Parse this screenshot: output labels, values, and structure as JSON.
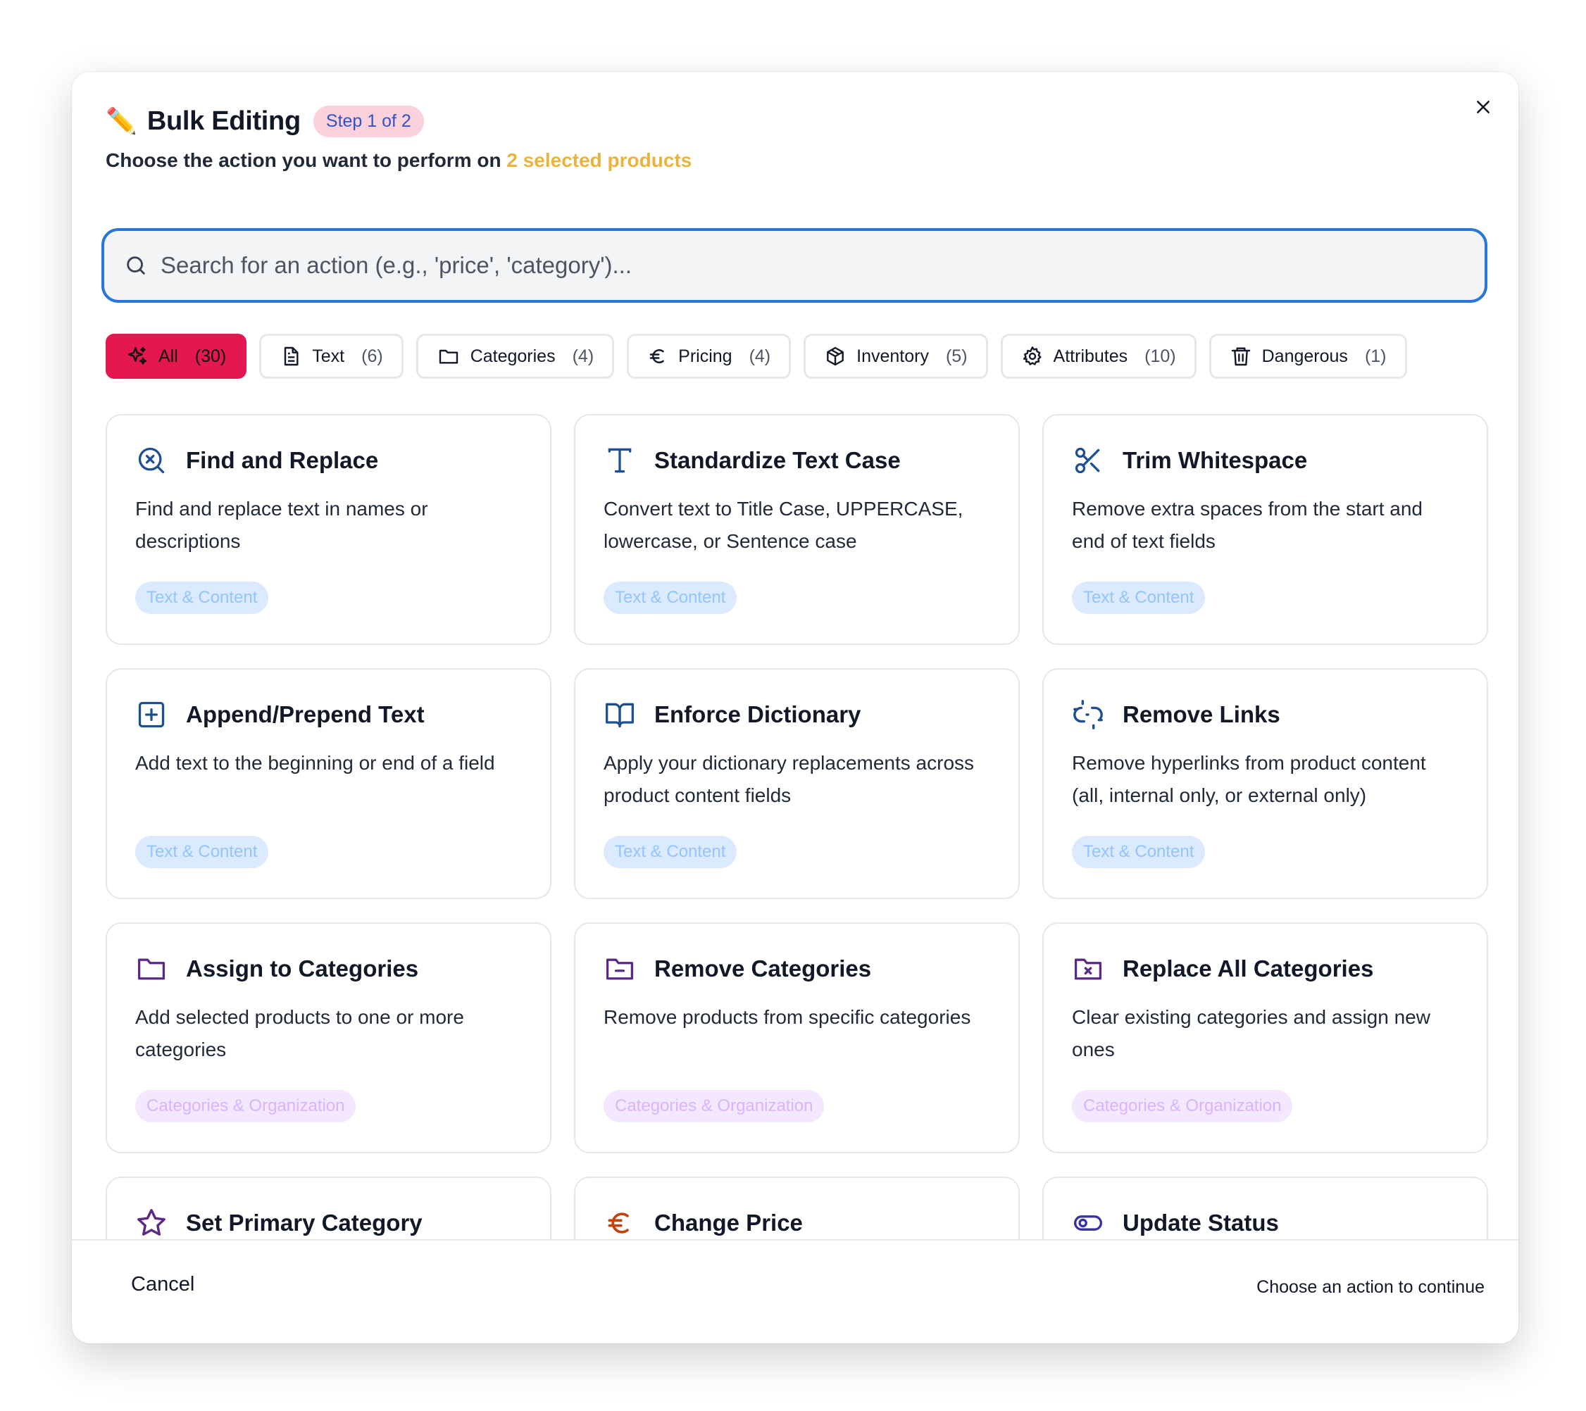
{
  "header": {
    "pencil": "✏️",
    "title": "Bulk Editing",
    "step": "Step 1 of 2",
    "subtitle_prefix": "Choose the action you want to perform on",
    "subtitle_highlight": "2 selected products",
    "close_icon": "close-icon"
  },
  "search": {
    "placeholder": "Search for an action (e.g., 'price', 'category')...",
    "value": ""
  },
  "filters": [
    {
      "label": "All",
      "count": "(30)",
      "icon": "sparkles-icon",
      "active": true
    },
    {
      "label": "Text",
      "count": "(6)",
      "icon": "document-icon"
    },
    {
      "label": "Categories",
      "count": "(4)",
      "icon": "folder-icon"
    },
    {
      "label": "Pricing",
      "count": "(4)",
      "icon": "euro-icon"
    },
    {
      "label": "Inventory",
      "count": "(5)",
      "icon": "box-icon"
    },
    {
      "label": "Attributes",
      "count": "(10)",
      "icon": "gear-icon"
    },
    {
      "label": "Dangerous",
      "count": "(1)",
      "icon": "trash-icon"
    }
  ],
  "cards": [
    {
      "title": "Find and Replace",
      "desc": "Find and replace text in names or descriptions",
      "tag": "Text & Content",
      "icon": "search-x-icon"
    },
    {
      "title": "Standardize Text Case",
      "desc": "Convert text to Title Case, UPPERCASE, lowercase, or Sentence case",
      "tag": "Text & Content",
      "icon": "text-type-icon"
    },
    {
      "title": "Trim Whitespace",
      "desc": "Remove extra spaces from the start and end of text fields",
      "tag": "Text & Content",
      "icon": "scissors-icon"
    },
    {
      "title": "Append/Prepend Text",
      "desc": "Add text to the beginning or end of a field",
      "tag": "Text & Content",
      "icon": "plus-square-icon"
    },
    {
      "title": "Enforce Dictionary",
      "desc": "Apply your dictionary replacements across product content fields",
      "tag": "Text & Content",
      "icon": "book-open-icon"
    },
    {
      "title": "Remove Links",
      "desc": "Remove hyperlinks from product content (all, internal only, or external only)",
      "tag": "Text & Content",
      "icon": "unlink-icon"
    },
    {
      "title": "Assign to Categories",
      "desc": "Add selected products to one or more categories",
      "tag": "Categories & Organization",
      "icon": "folder-icon"
    },
    {
      "title": "Remove Categories",
      "desc": "Remove products from specific categories",
      "tag": "Categories & Organization",
      "icon": "folder-minus-icon"
    },
    {
      "title": "Replace All Categories",
      "desc": "Clear existing categories and assign new ones",
      "tag": "Categories & Organization",
      "icon": "folder-x-icon"
    },
    {
      "title": "Set Primary Category",
      "desc": "",
      "tag": "",
      "icon": "star-icon"
    },
    {
      "title": "Change Price",
      "desc": "",
      "tag": "",
      "icon": "euro-icon"
    },
    {
      "title": "Update Status",
      "desc": "",
      "tag": "",
      "icon": "toggle-icon"
    }
  ],
  "footer": {
    "cancel": "Cancel",
    "hint": "Choose an action to continue"
  },
  "colors": {
    "accent": "#e4174f",
    "search_border": "#2577d9",
    "highlight": "#e8b43c",
    "text_icon": "#1d4f91",
    "category_icon": "#5b2a86",
    "pricing_icon": "#c2410c",
    "status_icon": "#3730a3"
  }
}
